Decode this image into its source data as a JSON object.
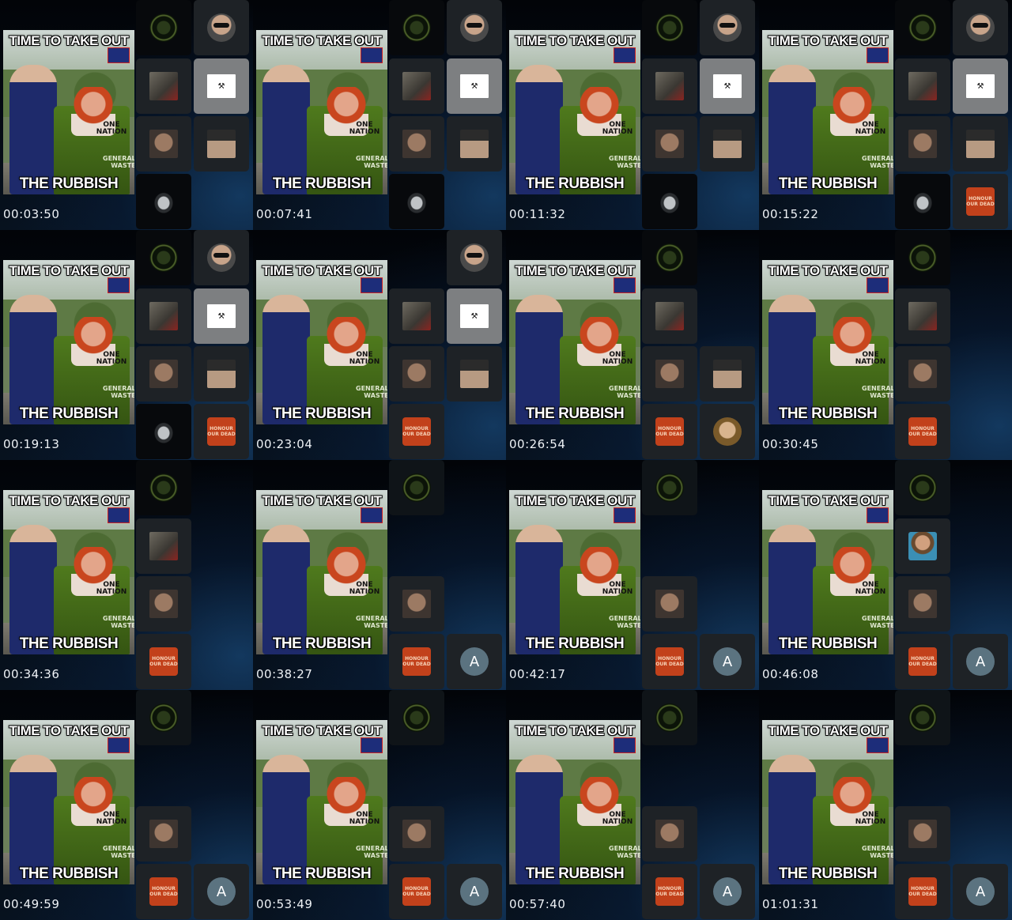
{
  "meme": {
    "top_text": "TIME TO TAKE OUT",
    "bottom_text": "THE RUBBISH",
    "bin_label": "ONE NATION",
    "bin_side": "GENERAL WASTE"
  },
  "frames": [
    {
      "timestamp": "00:03:50",
      "tiles": [
        [
          "clan",
          "dark"
        ],
        [
          "sunglasses",
          "normal"
        ],
        [
          "protest",
          "normal"
        ],
        [
          "logo",
          "white"
        ],
        [
          "face",
          "normal"
        ],
        [
          "cap",
          "normal"
        ],
        [
          "bird",
          "dark"
        ]
      ]
    },
    {
      "timestamp": "00:07:41",
      "tiles": [
        [
          "clan",
          "dark"
        ],
        [
          "sunglasses",
          "normal"
        ],
        [
          "protest",
          "normal"
        ],
        [
          "logo",
          "white"
        ],
        [
          "face",
          "normal"
        ],
        [
          "cap",
          "normal"
        ],
        [
          "bird",
          "dark"
        ]
      ]
    },
    {
      "timestamp": "00:11:32",
      "tiles": [
        [
          "clan",
          "dark"
        ],
        [
          "sunglasses",
          "normal"
        ],
        [
          "protest",
          "normal"
        ],
        [
          "logo",
          "white"
        ],
        [
          "face",
          "normal"
        ],
        [
          "cap",
          "normal"
        ],
        [
          "bird",
          "dark"
        ]
      ]
    },
    {
      "timestamp": "00:15:22",
      "tiles": [
        [
          "clan",
          "dark"
        ],
        [
          "sunglasses",
          "normal"
        ],
        [
          "protest",
          "normal"
        ],
        [
          "logo",
          "white"
        ],
        [
          "face",
          "normal"
        ],
        [
          "cap",
          "normal"
        ],
        [
          "bird",
          "dark"
        ],
        [
          "honour",
          "normal"
        ]
      ]
    },
    {
      "timestamp": "00:19:13",
      "tiles": [
        [
          "clan",
          "dark"
        ],
        [
          "sunglasses",
          "normal"
        ],
        [
          "protest",
          "normal"
        ],
        [
          "logo",
          "white"
        ],
        [
          "face",
          "normal"
        ],
        [
          "cap",
          "normal"
        ],
        [
          "bird",
          "dark"
        ],
        [
          "honour",
          "normal"
        ]
      ]
    },
    {
      "timestamp": "00:23:04",
      "tiles": [
        [
          "empty",
          "none"
        ],
        [
          "sunglasses",
          "normal"
        ],
        [
          "protest",
          "normal"
        ],
        [
          "logo",
          "white"
        ],
        [
          "face",
          "normal"
        ],
        [
          "cap",
          "normal"
        ],
        [
          "honour",
          "normal"
        ],
        [
          "empty",
          "none"
        ]
      ]
    },
    {
      "timestamp": "00:26:54",
      "tiles": [
        [
          "clan",
          "dark"
        ],
        [
          "empty",
          "none"
        ],
        [
          "protest",
          "normal"
        ],
        [
          "empty",
          "none"
        ],
        [
          "face",
          "normal"
        ],
        [
          "cap",
          "normal"
        ],
        [
          "honour",
          "normal"
        ],
        [
          "girl",
          "normal"
        ]
      ]
    },
    {
      "timestamp": "00:30:45",
      "tiles": [
        [
          "clan",
          "dark"
        ],
        [
          "empty",
          "none"
        ],
        [
          "protest",
          "normal"
        ],
        [
          "empty",
          "none"
        ],
        [
          "face",
          "normal"
        ],
        [
          "empty",
          "none"
        ],
        [
          "honour",
          "normal"
        ]
      ]
    },
    {
      "timestamp": "00:34:36",
      "tiles": [
        [
          "clan",
          "dark"
        ],
        [
          "empty",
          "none"
        ],
        [
          "protest",
          "normal"
        ],
        [
          "empty",
          "none"
        ],
        [
          "face",
          "normal"
        ],
        [
          "empty",
          "none"
        ],
        [
          "honour",
          "normal"
        ]
      ]
    },
    {
      "timestamp": "00:38:27",
      "tiles": [
        [
          "clan",
          "fade"
        ],
        [
          "empty",
          "none"
        ],
        [
          "empty",
          "none"
        ],
        [
          "empty",
          "none"
        ],
        [
          "face",
          "normal"
        ],
        [
          "empty",
          "none"
        ],
        [
          "honour",
          "normal"
        ],
        [
          "avatar",
          "normal"
        ]
      ]
    },
    {
      "timestamp": "00:42:17",
      "tiles": [
        [
          "clan",
          "fade"
        ],
        [
          "empty",
          "none"
        ],
        [
          "empty",
          "none"
        ],
        [
          "empty",
          "none"
        ],
        [
          "face",
          "normal"
        ],
        [
          "empty",
          "none"
        ],
        [
          "honour",
          "normal"
        ],
        [
          "avatar",
          "normal"
        ]
      ]
    },
    {
      "timestamp": "00:46:08",
      "tiles": [
        [
          "clan",
          "fade"
        ],
        [
          "empty",
          "none"
        ],
        [
          "beard",
          "normal"
        ],
        [
          "empty",
          "none"
        ],
        [
          "face",
          "normal"
        ],
        [
          "empty",
          "none"
        ],
        [
          "honour",
          "normal"
        ],
        [
          "avatar",
          "normal"
        ]
      ]
    },
    {
      "timestamp": "00:49:59",
      "tiles": [
        [
          "clan",
          "fade"
        ],
        [
          "empty",
          "none"
        ],
        [
          "empty",
          "none"
        ],
        [
          "empty",
          "none"
        ],
        [
          "face",
          "normal"
        ],
        [
          "empty",
          "none"
        ],
        [
          "honour",
          "normal"
        ],
        [
          "avatar",
          "normal"
        ]
      ]
    },
    {
      "timestamp": "00:53:49",
      "tiles": [
        [
          "clan",
          "fade"
        ],
        [
          "empty",
          "none"
        ],
        [
          "empty",
          "none"
        ],
        [
          "empty",
          "none"
        ],
        [
          "face",
          "normal"
        ],
        [
          "empty",
          "none"
        ],
        [
          "honour",
          "normal"
        ],
        [
          "avatar",
          "normal"
        ]
      ]
    },
    {
      "timestamp": "00:57:40",
      "tiles": [
        [
          "clan",
          "fade"
        ],
        [
          "empty",
          "none"
        ],
        [
          "empty",
          "none"
        ],
        [
          "empty",
          "none"
        ],
        [
          "face",
          "normal"
        ],
        [
          "empty",
          "none"
        ],
        [
          "honour",
          "normal"
        ],
        [
          "avatar",
          "normal"
        ]
      ]
    },
    {
      "timestamp": "01:01:31",
      "tiles": [
        [
          "clan",
          "fade"
        ],
        [
          "empty",
          "none"
        ],
        [
          "empty",
          "none"
        ],
        [
          "empty",
          "none"
        ],
        [
          "face",
          "normal"
        ],
        [
          "empty",
          "none"
        ],
        [
          "honour",
          "normal"
        ],
        [
          "avatar",
          "normal"
        ]
      ]
    }
  ],
  "tile_text": {
    "logo": "⚒",
    "honour": "HONOUR OUR DEAD",
    "avatar": "A"
  },
  "tile_names": {
    "clan": "clan-emblem-tile",
    "sunglasses": "sunglasses-avatar-tile",
    "protest": "protest-photo-tile",
    "logo": "construction-logo-tile",
    "face": "bald-man-avatar-tile",
    "cap": "cap-man-avatar-tile",
    "bird": "bird-avatar-tile",
    "honour": "honour-our-dead-tile",
    "girl": "woman-avatar-tile",
    "beard": "bearded-man-avatar-tile",
    "avatar": "letter-a-avatar-tile"
  }
}
